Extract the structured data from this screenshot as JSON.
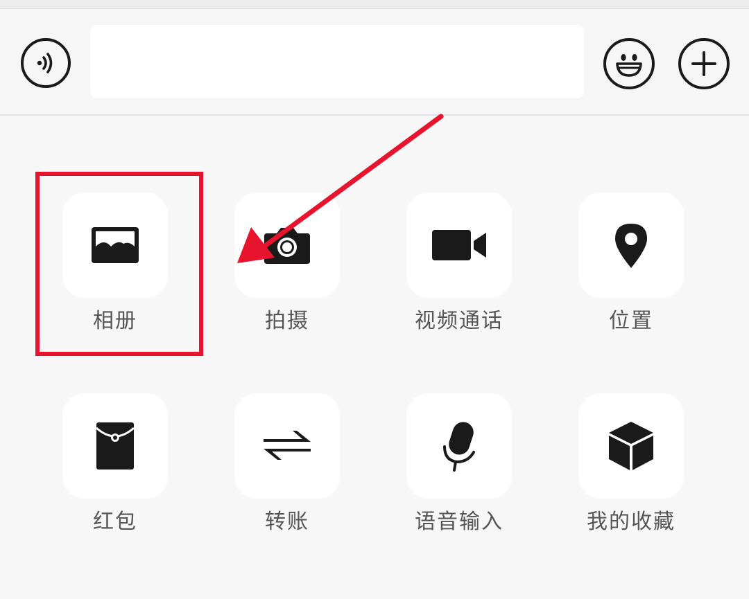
{
  "input_bar": {
    "voice_icon": "voice-wave-icon",
    "emoji_icon": "smiley-face-icon",
    "plus_icon": "plus-circle-icon",
    "text_value": "",
    "placeholder": ""
  },
  "panel": {
    "row1": [
      {
        "label": "相册",
        "icon": "photo-album-icon"
      },
      {
        "label": "拍摄",
        "icon": "camera-icon"
      },
      {
        "label": "视频通话",
        "icon": "video-camera-icon"
      },
      {
        "label": "位置",
        "icon": "location-pin-icon"
      }
    ],
    "row2": [
      {
        "label": "红包",
        "icon": "red-packet-icon"
      },
      {
        "label": "转账",
        "icon": "transfer-arrows-icon"
      },
      {
        "label": "语音输入",
        "icon": "microphone-icon"
      },
      {
        "label": "我的收藏",
        "icon": "favorites-cube-icon"
      }
    ]
  },
  "annotation": {
    "highlight_color": "#e8142e",
    "arrow_color": "#e8142e"
  }
}
